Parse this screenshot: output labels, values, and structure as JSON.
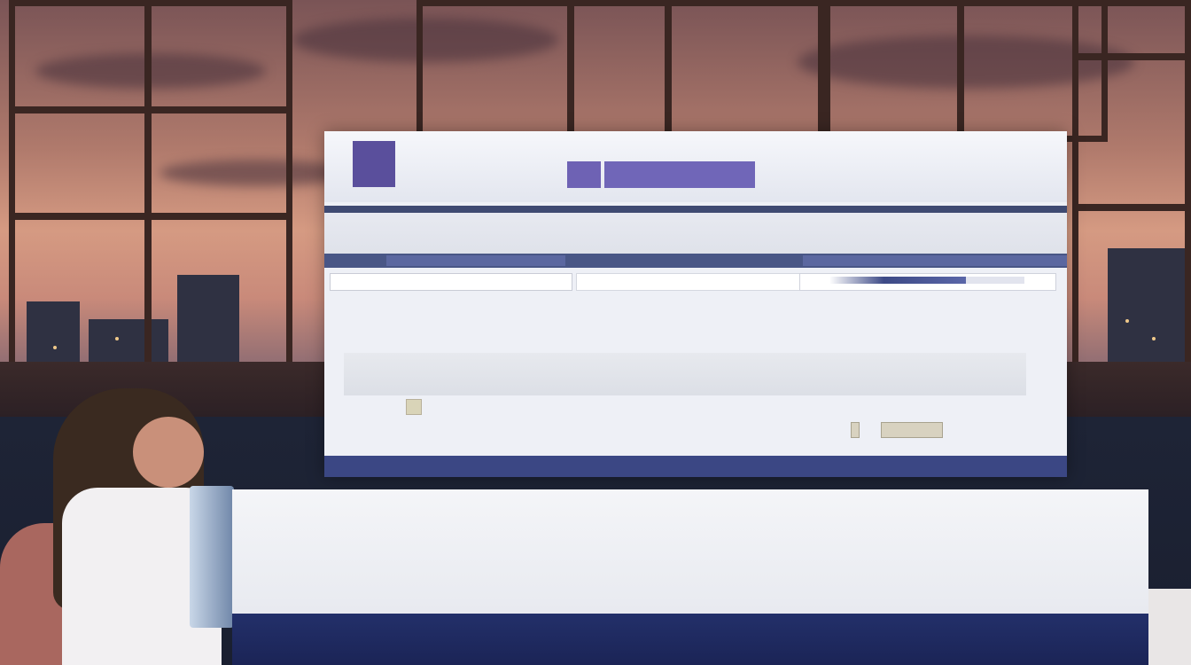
{
  "header": {
    "logo_text": "",
    "site_name": "",
    "button_1": "",
    "button_2": "",
    "title": ""
  },
  "nav_top": {
    "label": ""
  },
  "nav_secondary": [],
  "search": {
    "placeholder": "",
    "value": ""
  },
  "progress": {
    "fraction": 0.7
  },
  "section": {
    "title": "",
    "subtitle": "",
    "columns": []
  },
  "card": {
    "label": "",
    "code": ""
  },
  "row": {
    "title": "",
    "subtitle": "",
    "right_top": "",
    "right_bottom": ""
  },
  "banner": {
    "items": [
      {
        "title": "",
        "subtitle": ""
      },
      {
        "title": "",
        "subtitle": ""
      },
      {
        "title": "",
        "subtitle": ""
      }
    ]
  },
  "colors": {
    "brand_purple": "#5a4f9c",
    "nav_navy": "#3f4a72",
    "footer_navy": "#3b4784"
  }
}
